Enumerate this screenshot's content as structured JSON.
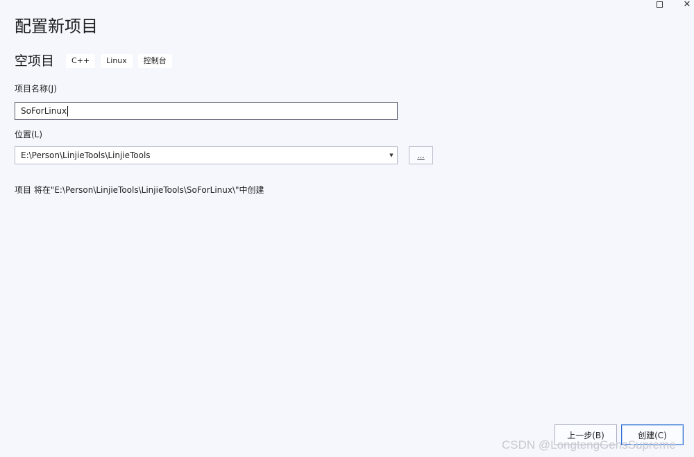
{
  "window": {
    "maximize_icon": "maximize-icon",
    "close_icon": "close-icon",
    "close_glyph": "✕"
  },
  "page": {
    "title": "配置新项目"
  },
  "template": {
    "name": "空项目",
    "tags": [
      "C++",
      "Linux",
      "控制台"
    ]
  },
  "form": {
    "project_name_label": "项目名称(J)",
    "project_name_value": "SoForLinux",
    "location_label": "位置(L)",
    "location_value": "E:\\Person\\LinjieTools\\LinjieTools",
    "browse_label": "...",
    "info_text": "项目 将在\"E:\\Person\\LinjieTools\\LinjieTools\\SoForLinux\\\"中创建"
  },
  "footer": {
    "back_label": "上一步(B)",
    "create_label": "创建(C)"
  },
  "watermark": "CSDN @LongtengGensSupreme",
  "colors": {
    "background": "#f5f7fd",
    "primary_border": "#2d6fd1"
  }
}
